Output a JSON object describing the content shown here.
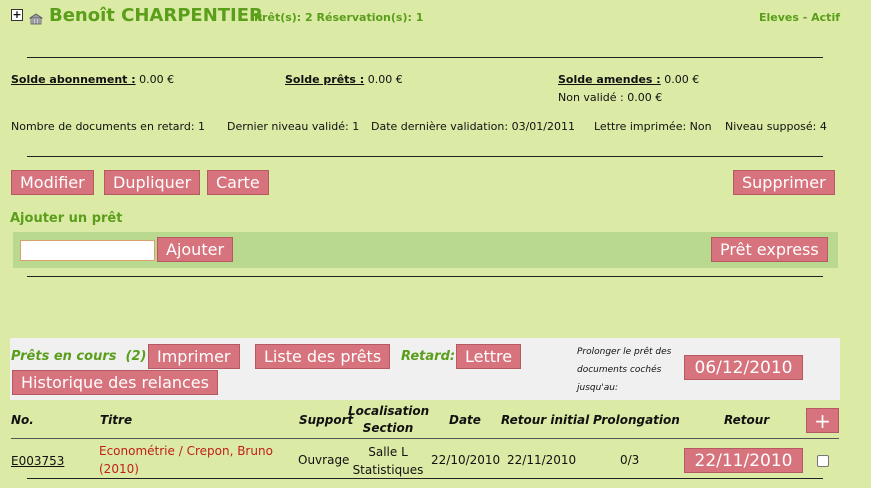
{
  "header": {
    "expand_glyph": "+",
    "reader_name": "Benoît CHARPENTIER",
    "reader_counts": "Prêt(s): 2 Réservation(s): 1",
    "reader_status": "Eleves - Actif"
  },
  "balances": {
    "subscription_label": "Solde abonnement :",
    "subscription_value": " 0.00 €",
    "loans_label": "Solde prêts :",
    "loans_value": " 0.00 €",
    "fines_label": "Solde amendes :",
    "fines_value": " 0.00 €",
    "fines_unvalidated": "Non validé : 0.00 €"
  },
  "info": {
    "overdue_docs": "Nombre de documents en retard: 1",
    "last_level": "Dernier niveau validé: 1",
    "last_validation": "Date dernière validation: 03/01/2011",
    "letter_printed": "Lettre imprimée: Non",
    "supposed_level": "Niveau supposé: 4"
  },
  "toolbar": {
    "modify_label": "Modifier",
    "duplicate_label": "Dupliquer",
    "card_label": "Carte",
    "delete_label": "Supprimer"
  },
  "add_loan": {
    "title": "Ajouter un prêt",
    "input_value": "",
    "add_label": "Ajouter",
    "express_label": "Prêt express"
  },
  "loans": {
    "title": "Prêts en cours",
    "count": "(2)",
    "print_label": "Imprimer",
    "list_label": "Liste des prêts",
    "overdue_label": "Retard:",
    "letter_label": "Lettre",
    "history_label": "Historique des relances",
    "prolong_text": "Prolonger le prêt des documents cochés jusqu'au:",
    "prolong_date": "06/12/2010"
  },
  "table": {
    "col_no": "No.",
    "col_title": "Titre",
    "col_support": "Support",
    "col_location_1": "Localisation",
    "col_location_2": "Section",
    "col_date": "Date",
    "col_initial_return": "Retour initial",
    "col_extension": "Prolongation",
    "col_return": "Retour",
    "add_glyph": "+",
    "rows": [
      {
        "no": "E003753",
        "title_1": "Econométrie / Crepon, Bruno",
        "title_2": "(2010)",
        "support": "Ouvrage",
        "location": "Salle L",
        "section": "Statistiques",
        "date": "22/10/2010",
        "initial_return": "22/11/2010",
        "extension": "0/3",
        "return_date": "22/11/2010"
      }
    ]
  }
}
